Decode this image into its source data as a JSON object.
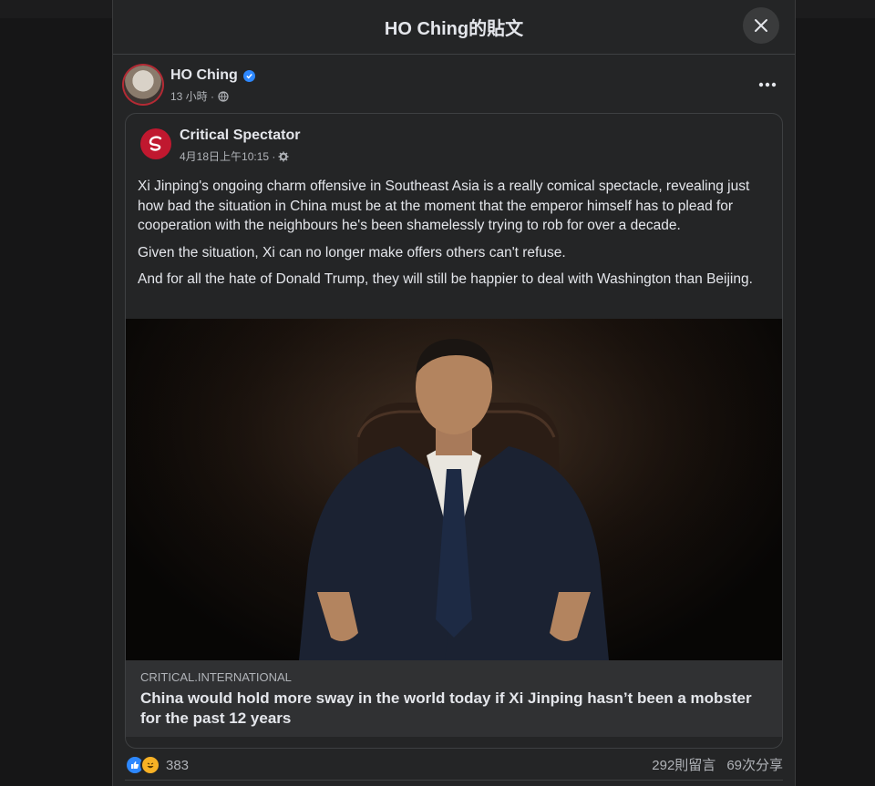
{
  "modal": {
    "title": "HO Ching的貼文"
  },
  "post": {
    "author": "HO Ching",
    "time": "13 小時 ·",
    "shared": {
      "page_name": "Critical Spectator",
      "date": "4月18日上午10:15 ·",
      "paragraphs": [
        "Xi Jinping's ongoing charm offensive in Southeast Asia is a really comical spectacle, revealing just how bad the situation in China must be at the moment that the emperor himself has to plead for cooperation with the neighbours he's been shamelessly trying to rob for over a decade.",
        "Given the situation, Xi can no longer make offers others can't refuse.",
        "And for all the hate of Donald Trump, they will still be happier to deal with Washington than Beijing."
      ],
      "link": {
        "domain": "CRITICAL.INTERNATIONAL",
        "title": "China would hold more sway in the world today if Xi Jinping hasn’t been a mobster for the past 12 years"
      }
    },
    "stats": {
      "reactions": "383",
      "comments": "292則留言",
      "shares": "69次分享"
    }
  },
  "icons": [
    "close-icon",
    "verified-icon",
    "globe-icon",
    "more-icon",
    "gear-icon",
    "like-reaction-icon",
    "haha-reaction-icon"
  ],
  "colors": {
    "accent": "#2d88ff",
    "brand_red": "#c0182f"
  }
}
